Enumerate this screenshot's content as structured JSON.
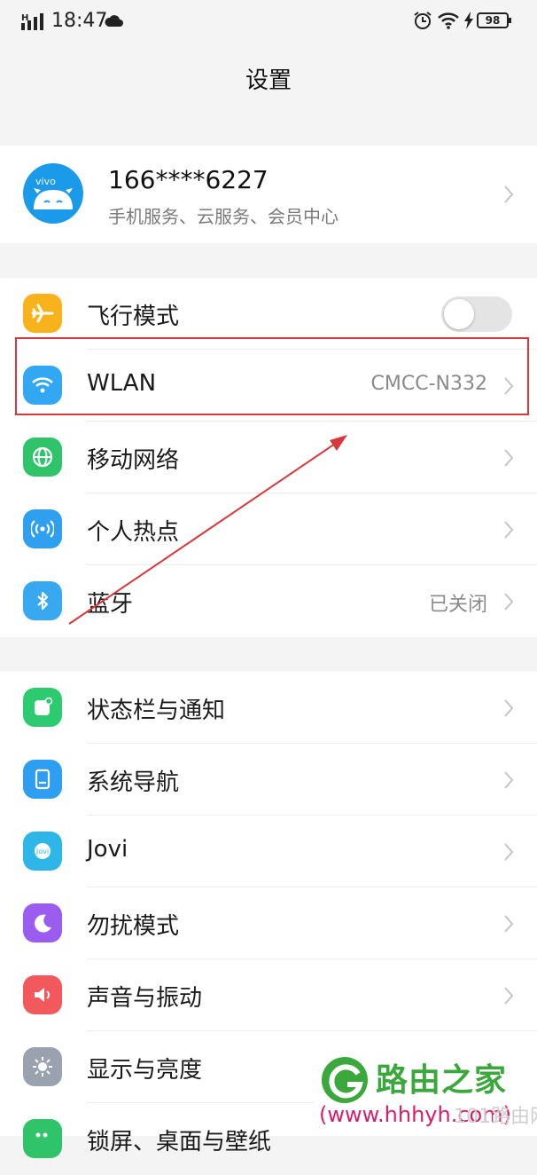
{
  "status_bar": {
    "network": "H",
    "time": "18:47",
    "battery": "98"
  },
  "header": {
    "title": "设置"
  },
  "account": {
    "avatar_text": "vivo",
    "name": "166****6227",
    "subtitle": "手机服务、云服务、会员中心"
  },
  "connectivity": [
    {
      "label": "飞行模式",
      "icon": "airplane-icon",
      "color": "#f7b21c",
      "toggle": false
    },
    {
      "label": "WLAN",
      "icon": "wifi-icon",
      "color": "#33a8f2",
      "value": "CMCC-N332"
    },
    {
      "label": "移动网络",
      "icon": "globe-icon",
      "color": "#2fc46a"
    },
    {
      "label": "个人热点",
      "icon": "hotspot-icon",
      "color": "#2f9ff0"
    },
    {
      "label": "蓝牙",
      "icon": "bluetooth-icon",
      "color": "#38a9f0",
      "value": "已关闭"
    }
  ],
  "system": [
    {
      "label": "状态栏与通知",
      "icon": "notification-icon",
      "color": "#2ccb70"
    },
    {
      "label": "系统导航",
      "icon": "navigation-icon",
      "color": "#2e9ef0"
    },
    {
      "label": "Jovi",
      "icon": "jovi-icon",
      "color": "#2fb6e8",
      "icon_text": "Jovi"
    },
    {
      "label": "勿扰模式",
      "icon": "moon-icon",
      "color": "#9b5cf0"
    },
    {
      "label": "声音与振动",
      "icon": "speaker-icon",
      "color": "#f2595c"
    },
    {
      "label": "显示与亮度",
      "icon": "sun-icon",
      "color": "#9aa2b0"
    },
    {
      "label": "锁屏、桌面与壁纸",
      "icon": "wallpaper-icon",
      "color": "#2fc46a"
    }
  ],
  "watermark": {
    "title": "路由之家",
    "url": "(www.hhhyh.com)",
    "sub": "101路由网"
  },
  "colors": {
    "highlight": "#d9383a",
    "background": "#f4f4f4"
  }
}
